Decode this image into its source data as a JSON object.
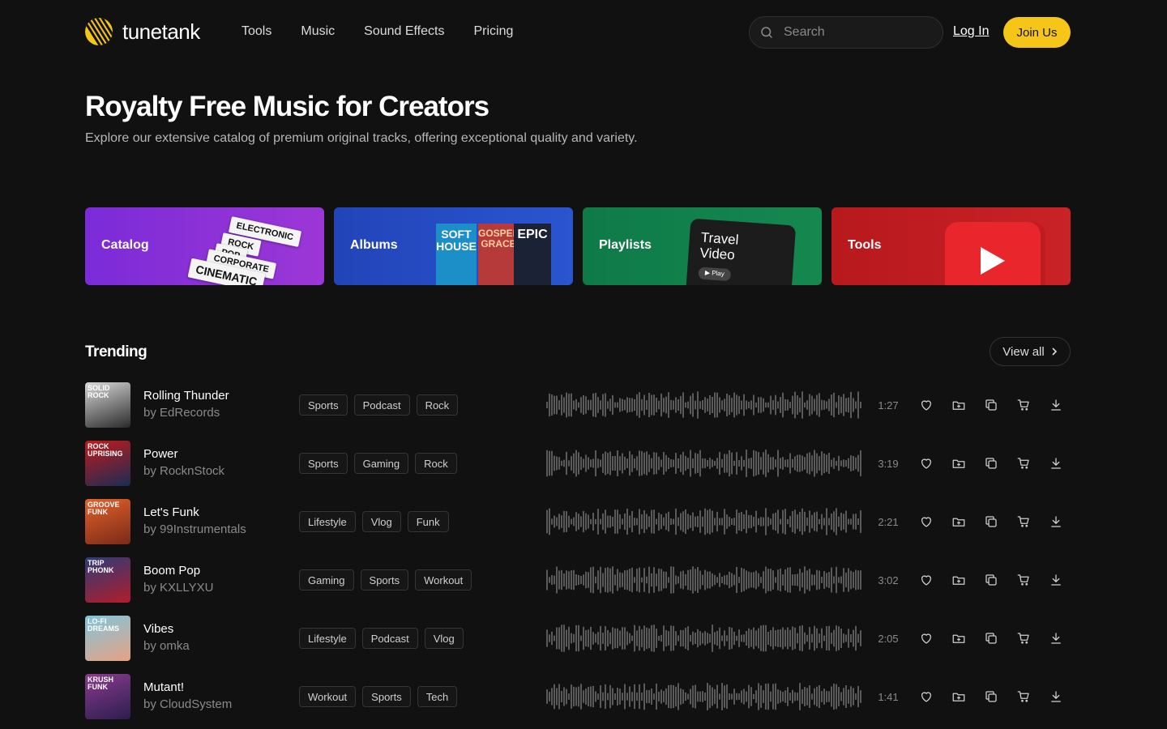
{
  "header": {
    "brand": "tunetank",
    "nav": [
      "Tools",
      "Music",
      "Sound Effects",
      "Pricing"
    ],
    "search_placeholder": "Search",
    "login": "Log In",
    "join": "Join Us"
  },
  "hero": {
    "title": "Royalty Free Music for Creators",
    "subtitle": "Explore our extensive catalog of premium original tracks, offering exceptional quality and variety."
  },
  "categories": [
    {
      "label": "Catalog",
      "art": [
        "ELECTRONIC",
        "ROCK",
        "POP",
        "CORPORATE",
        "CINEMATIC"
      ]
    },
    {
      "label": "Albums",
      "art": [
        "SOFT HOUSE",
        "GOSPEL GRACE",
        "EPIC"
      ]
    },
    {
      "label": "Playlists",
      "art": [
        "Travel",
        "Video",
        "▶ Play"
      ]
    },
    {
      "label": "Tools"
    }
  ],
  "trending": {
    "title": "Trending",
    "view_all": "View all",
    "tracks": [
      {
        "name": "Rolling Thunder",
        "artist": "by EdRecords",
        "tags": [
          "Sports",
          "Podcast",
          "Rock"
        ],
        "duration": "1:27",
        "cover_text": "SOLID ROCK",
        "cover_colors": [
          "#d9d9d9",
          "#2a2a2a"
        ]
      },
      {
        "name": "Power",
        "artist": "by RocknStock",
        "tags": [
          "Sports",
          "Gaming",
          "Rock"
        ],
        "duration": "3:19",
        "cover_text": "ROCK UPRISING",
        "cover_colors": [
          "#c21a1a",
          "#1b2c55"
        ]
      },
      {
        "name": "Let's Funk",
        "artist": "by 99Instrumentals",
        "tags": [
          "Lifestyle",
          "Vlog",
          "Funk"
        ],
        "duration": "2:21",
        "cover_text": "GROOVE FUNK",
        "cover_colors": [
          "#e4622a",
          "#7a2a18"
        ]
      },
      {
        "name": "Boom Pop",
        "artist": "by KXLLYXU",
        "tags": [
          "Gaming",
          "Sports",
          "Workout"
        ],
        "duration": "3:02",
        "cover_text": "TRIP PHONK",
        "cover_colors": [
          "#2d3b7a",
          "#b11d2a"
        ]
      },
      {
        "name": "Vibes",
        "artist": "by omka",
        "tags": [
          "Lifestyle",
          "Podcast",
          "Vlog"
        ],
        "duration": "2:05",
        "cover_text": "LO-FI DREAMS",
        "cover_colors": [
          "#7fc6d9",
          "#e6a184"
        ]
      },
      {
        "name": "Mutant!",
        "artist": "by CloudSystem",
        "tags": [
          "Workout",
          "Sports",
          "Tech"
        ],
        "duration": "1:41",
        "cover_text": "KRUSH FUNK",
        "cover_colors": [
          "#8c3a8f",
          "#2b1f4d"
        ]
      }
    ]
  },
  "icons": [
    "search-icon",
    "heart-icon",
    "folder-plus-icon",
    "copy-icon",
    "cart-icon",
    "download-icon",
    "chevron-right-icon",
    "play-icon"
  ],
  "colors": {
    "accent": "#f5c518",
    "background": "#111111"
  }
}
